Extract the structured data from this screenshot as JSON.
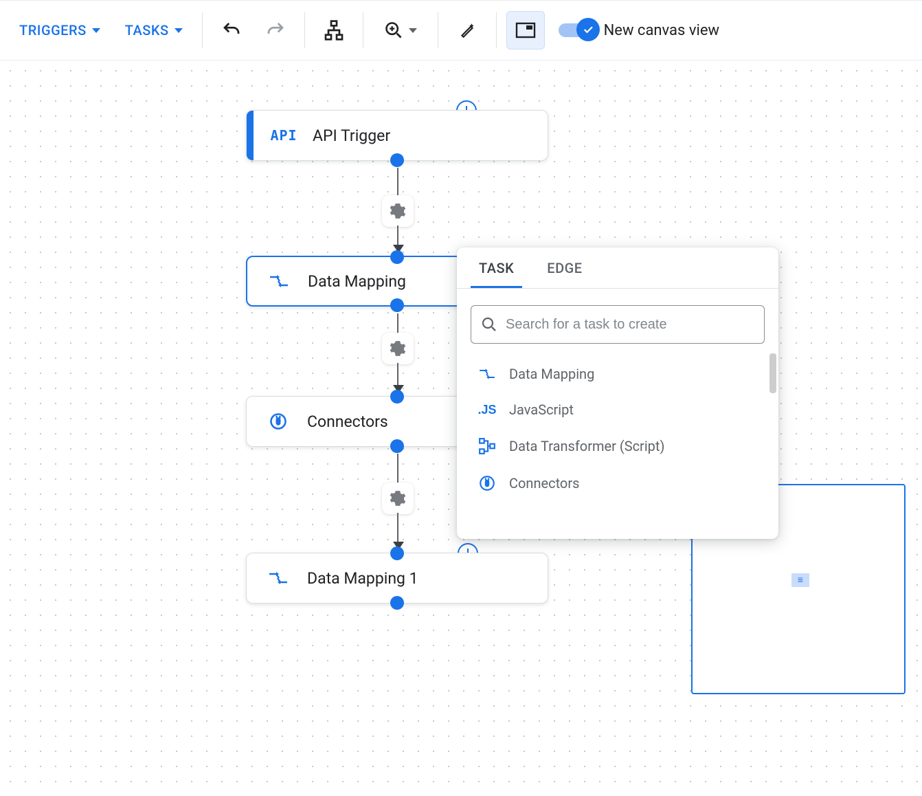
{
  "toolbar": {
    "triggers_label": "TRIGGERS",
    "tasks_label": "TASKS",
    "new_canvas_label": "New canvas view"
  },
  "nodes": {
    "api_trigger": {
      "label": "API Trigger",
      "icon_text": "API"
    },
    "data_mapping": {
      "label": "Data Mapping"
    },
    "connectors": {
      "label": "Connectors"
    },
    "data_mapping_1": {
      "label": "Data Mapping 1"
    }
  },
  "popup": {
    "tabs": {
      "task": "TASK",
      "edge": "EDGE"
    },
    "search_placeholder": "Search for a task to create",
    "items": {
      "data_mapping": "Data Mapping",
      "javascript": "JavaScript",
      "javascript_icon": ".JS",
      "data_transformer": "Data Transformer (Script)",
      "connectors": "Connectors"
    }
  }
}
